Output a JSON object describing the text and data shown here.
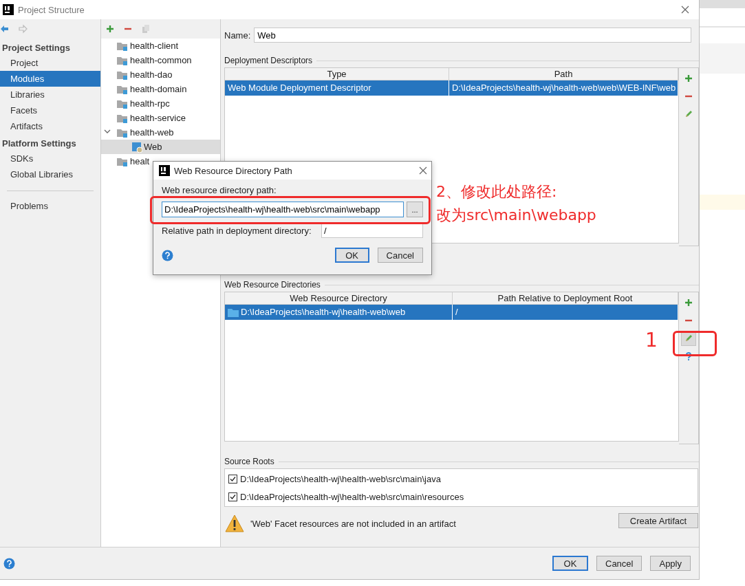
{
  "window": {
    "title": "Project Structure"
  },
  "nav": [
    {
      "kind": "back",
      "disabled": false
    },
    {
      "kind": "forward",
      "disabled": true
    }
  ],
  "sidebar": {
    "sections": [
      {
        "title": "Project Settings",
        "items": [
          {
            "label": "Project",
            "selected": false
          },
          {
            "label": "Modules",
            "selected": true
          },
          {
            "label": "Libraries",
            "selected": false
          },
          {
            "label": "Facets",
            "selected": false
          },
          {
            "label": "Artifacts",
            "selected": false
          }
        ]
      },
      {
        "title": "Platform Settings",
        "items": [
          {
            "label": "SDKs",
            "selected": false
          },
          {
            "label": "Global Libraries",
            "selected": false
          }
        ]
      }
    ],
    "extra_items": [
      {
        "label": "Problems",
        "selected": false
      }
    ]
  },
  "tree_toolbar": [
    {
      "kind": "add",
      "disabled": false
    },
    {
      "kind": "remove",
      "disabled": false
    },
    {
      "kind": "copy",
      "disabled": true
    }
  ],
  "module_tree": [
    {
      "label": "health-client",
      "kind": "module",
      "selected": false
    },
    {
      "label": "health-common",
      "kind": "module",
      "selected": false
    },
    {
      "label": "health-dao",
      "kind": "module",
      "selected": false
    },
    {
      "label": "health-domain",
      "kind": "module",
      "selected": false
    },
    {
      "label": "health-rpc",
      "kind": "module",
      "selected": false
    },
    {
      "label": "health-service",
      "kind": "module",
      "selected": false
    },
    {
      "label": "health-web",
      "kind": "module",
      "selected": false,
      "expanded": true,
      "children": [
        {
          "label": "Web",
          "kind": "facet",
          "selected": true
        }
      ]
    },
    {
      "label": "healt",
      "kind": "module",
      "selected": false
    }
  ],
  "name_field": {
    "label": "Name:",
    "value": "Web"
  },
  "deployment_descriptors": {
    "title": "Deployment Descriptors",
    "columns": [
      "Type",
      "Path"
    ],
    "rows": [
      {
        "cells": [
          "Web Module Deployment Descriptor",
          "D:\\IdeaProjects\\health-wj\\health-web\\web\\WEB-INF\\web"
        ],
        "selected": true
      }
    ],
    "tools": [
      {
        "kind": "add",
        "hovered": false
      },
      {
        "kind": "remove",
        "hovered": false
      },
      {
        "kind": "edit",
        "hovered": false
      }
    ]
  },
  "web_resource_directories": {
    "title": "Web Resource Directories",
    "columns": [
      "Web Resource Directory",
      "Path Relative to Deployment Root"
    ],
    "rows": [
      {
        "cells": [
          "D:\\IdeaProjects\\health-wj\\health-web\\web",
          "/"
        ],
        "selected": true
      }
    ],
    "tools": [
      {
        "kind": "add",
        "hovered": false
      },
      {
        "kind": "remove",
        "hovered": false
      },
      {
        "kind": "edit",
        "hovered": true
      },
      {
        "kind": "help",
        "hovered": false
      }
    ]
  },
  "source_roots": {
    "title": "Source Roots",
    "items": [
      {
        "path": "D:\\IdeaProjects\\health-wj\\health-web\\src\\main\\java",
        "checked": true
      },
      {
        "path": "D:\\IdeaProjects\\health-wj\\health-web\\src\\main\\resources",
        "checked": true
      }
    ]
  },
  "warning": {
    "text": "'Web' Facet resources are not included in an artifact",
    "button": "Create Artifact"
  },
  "buttons": [
    {
      "label": "OK",
      "default": true
    },
    {
      "label": "Cancel",
      "default": false
    },
    {
      "label": "Apply",
      "default": false
    }
  ],
  "dialog": {
    "title": "Web Resource Directory Path",
    "path_label": "Web resource directory path:",
    "path_value": "D:\\IdeaProjects\\health-wj\\health-web\\src\\main\\webapp",
    "browse_button": "...",
    "relative_label": "Relative path in deployment directory:",
    "relative_value": "/",
    "buttons": [
      {
        "label": "OK",
        "default": true
      },
      {
        "label": "Cancel",
        "default": false
      }
    ]
  },
  "annotations": {
    "step_1": "1",
    "step_2": [
      "2、修改此处路径:",
      "改为src\\main\\webapp"
    ]
  }
}
